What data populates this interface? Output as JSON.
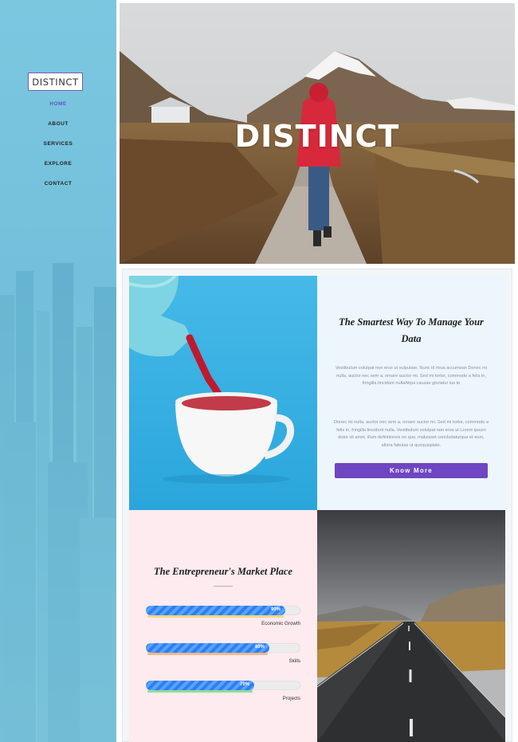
{
  "sidebar": {
    "logo": "DISTINCT",
    "nav": [
      {
        "label": "HOME",
        "active": true
      },
      {
        "label": "ABOUT",
        "active": false
      },
      {
        "label": "SERVICES",
        "active": false
      },
      {
        "label": "EXPLORE",
        "active": false
      },
      {
        "label": "CONTACT",
        "active": false
      }
    ]
  },
  "hero": {
    "title": "DISTINCT"
  },
  "smartest": {
    "title": "The Smartest Way To Manage Your Data",
    "paragraph1": "Vestibulum volutpat non eros ut vulputate. Nunc id risus accumsan Donec mi nulla, auctor nec sem a, ornare auctor mi. Sed mi tortor, commodo a felis in, fringilla tincidunt nullaAtqui causae gloriatur ius te",
    "paragraph2": "Donec mi nulla, auctor nec sem a, ornare auctor mi. Sed mi tortor, commodo a felis in, fringilla tincidunt nulla. Vestibulum volutpat non eros ut Lorem ipsum dolor sit amet, illum definitiones no quo, maluisset concludaturque et eum, altera fabulas ut quoquisplate.",
    "button_label": "Know More",
    "button_color": "#6f45c2"
  },
  "entrepreneur": {
    "title": "The Entrepreneur's Market Place",
    "skills": [
      {
        "name": "Economic Growth",
        "percent": 90,
        "percent_label": "90%",
        "underline_color": "#f3d36b"
      },
      {
        "name": "Skills",
        "percent": 80,
        "percent_label": "80%",
        "underline_color": "#f2b27a"
      },
      {
        "name": "Projects",
        "percent": 70,
        "percent_label": "70%",
        "underline_color": "#7fdc86"
      }
    ]
  },
  "colors": {
    "sidebar": "#7cc7e0",
    "accent": "#6f45c2",
    "progress": "#2d7ff2"
  }
}
